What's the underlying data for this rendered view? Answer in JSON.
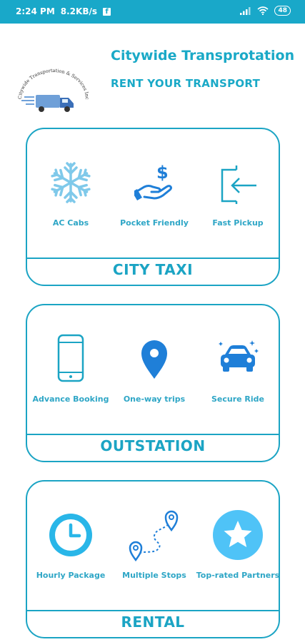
{
  "status_bar": {
    "time": "2:24 PM",
    "speed": "8.2KB/s",
    "battery": "48"
  },
  "header": {
    "logo_text": "Citywide Transportation & Services Inc",
    "title": "Citywide Transprotation",
    "subtitle": "RENT YOUR TRANSPORT"
  },
  "cards": [
    {
      "title": "CITY TAXI",
      "features": [
        {
          "label": "AC Cabs",
          "icon": "snowflake-icon"
        },
        {
          "label": "Pocket Friendly",
          "icon": "hand-dollar-icon"
        },
        {
          "label": "Fast Pickup",
          "icon": "enter-door-icon"
        }
      ]
    },
    {
      "title": "OUTSTATION",
      "features": [
        {
          "label": "Advance Booking",
          "icon": "smartphone-icon"
        },
        {
          "label": "One-way trips",
          "icon": "map-pin-icon"
        },
        {
          "label": "Secure Ride",
          "icon": "car-icon"
        }
      ]
    },
    {
      "title": "RENTAL",
      "features": [
        {
          "label": "Hourly Package",
          "icon": "clock-icon"
        },
        {
          "label": "Multiple Stops",
          "icon": "route-icon"
        },
        {
          "label": "Top-rated Partners",
          "icon": "star-badge-icon"
        }
      ]
    }
  ],
  "colors": {
    "accent": "#1ba4c4",
    "status_bar": "#19a8c9",
    "icon_blue": "#1f7fd8",
    "icon_light": "#4fc3f7"
  }
}
